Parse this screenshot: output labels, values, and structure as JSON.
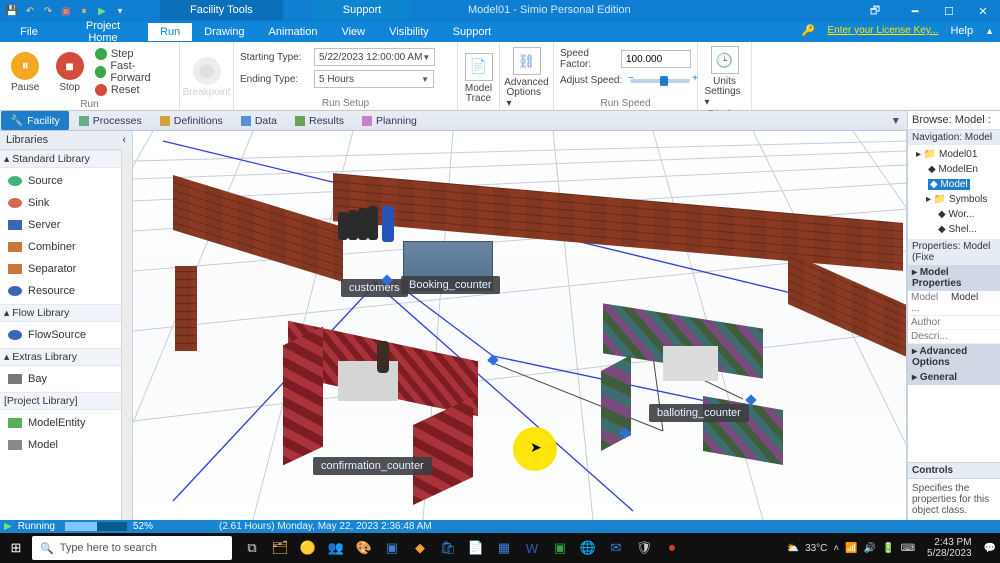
{
  "titlebar": {
    "context_tab": "Facility Tools",
    "support_tab": "Support",
    "doc_title": "Model01 - Simio Personal Edition",
    "restoredown_sym": "🗗"
  },
  "menubar": {
    "file": "File",
    "project_home": "Project Home",
    "run": "Run",
    "drawing": "Drawing",
    "animation": "Animation",
    "view": "View",
    "visibility": "Visibility",
    "support": "Support",
    "license_link": "Enter your License Key...",
    "help": "Help"
  },
  "ribbon": {
    "run": {
      "pause": "Pause",
      "stop": "Stop",
      "step": "Step",
      "ff": "Fast-Forward",
      "reset": "Reset",
      "group": "Run"
    },
    "break": {
      "label": "Breakpoint"
    },
    "setup": {
      "start_label": "Starting Type:",
      "start_value": "5/22/2023 12:00:00 AM",
      "end_label": "Ending Type:",
      "end_value": "5 Hours",
      "group": "Run Setup"
    },
    "trace": {
      "model": "Model",
      "trace": "Trace"
    },
    "adv": {
      "l1": "Advanced",
      "l2": "Options ▾"
    },
    "speed": {
      "factor_label": "Speed Factor:",
      "factor_value": "100.000",
      "adjust_label": "Adjust Speed:",
      "group": "Run Speed"
    },
    "units": {
      "l1": "Units",
      "l2": "Settings ▾",
      "group": "Display"
    }
  },
  "subtabs": {
    "facility": "Facility",
    "processes": "Processes",
    "definitions": "Definitions",
    "data": "Data",
    "results": "Results",
    "planning": "Planning"
  },
  "libraries": {
    "header": "Libraries",
    "std_hdr": "Standard Library",
    "std": {
      "source": "Source",
      "sink": "Sink",
      "server": "Server",
      "combiner": "Combiner",
      "separator": "Separator",
      "resource": "Resource"
    },
    "flow_hdr": "Flow Library",
    "flow": {
      "flowsource": "FlowSource"
    },
    "extras_hdr": "Extras Library",
    "extras": {
      "bay": "Bay"
    },
    "proj_hdr": "[Project Library]",
    "proj": {
      "modelentity": "ModelEntity",
      "model": "Model"
    }
  },
  "scene": {
    "customers": "customers",
    "booking": "Booking_counter",
    "confirmation": "confirmation_counter",
    "balloting": "balloting_counter"
  },
  "browse": {
    "title": "Browse: Model :",
    "nav_hdr": "Navigation: Model",
    "tree": {
      "root": "Model01",
      "modelent": "ModelEn",
      "model": "Model",
      "symbols": "Symbols",
      "wor": "Wor...",
      "shel": "Shel..."
    },
    "props_hdr": "Properties: Model (Fixe",
    "modelprops": "Model Properties",
    "row_model_k": "Model ...",
    "row_model_v": "Model",
    "row_author_k": "Author",
    "row_descr_k": "Descri...",
    "advopts": "Advanced Options",
    "general": "General",
    "controls": "Controls",
    "controls_txt": "Specifies the properties for this object class."
  },
  "simbar": {
    "state": "Running",
    "pct": "52%",
    "time": "(2.61 Hours) Monday, May 22, 2023 2:36:48 AM"
  },
  "taskbar": {
    "search_placeholder": "Type here to search",
    "temp": "33°C",
    "clock_time": "2:43 PM",
    "clock_date": "5/28/2023"
  }
}
